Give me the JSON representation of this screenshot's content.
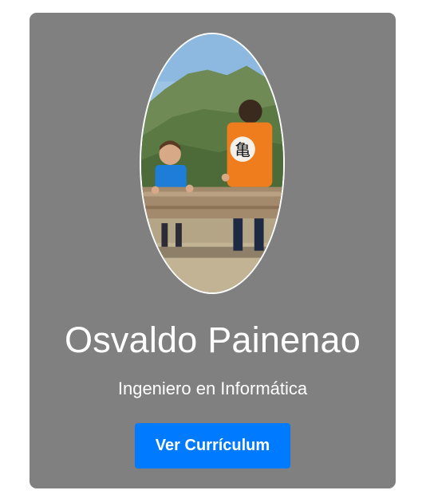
{
  "profile": {
    "name": "Osvaldo Painenao",
    "title": "Ingeniero en Informática",
    "cv_button_label": "Ver Currículum",
    "photo": "two children sitting on a wooden log bench in the mountains",
    "photo_shirt_symbol": "亀"
  },
  "colors": {
    "card_background": "#808080",
    "button_background": "#007bff",
    "text": "#ffffff"
  }
}
